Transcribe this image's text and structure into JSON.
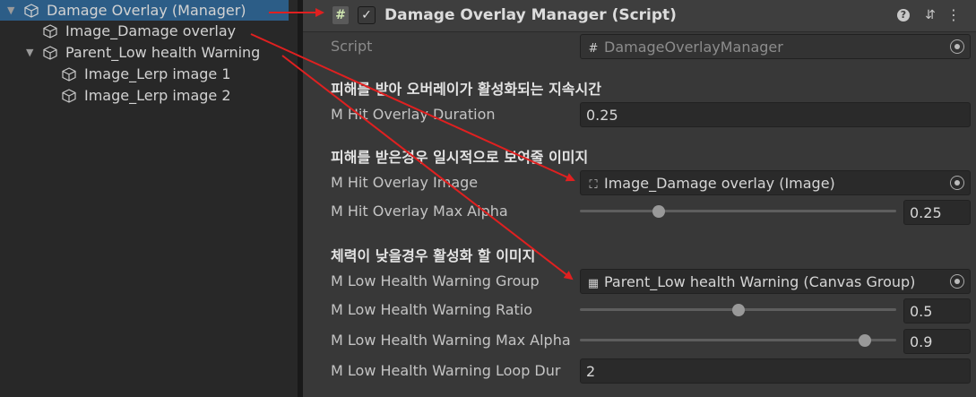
{
  "hierarchy": {
    "items": [
      {
        "label": "Damage Overlay (Manager)"
      },
      {
        "label": "Image_Damage overlay"
      },
      {
        "label": "Parent_Low health Warning"
      },
      {
        "label": "Image_Lerp image 1"
      },
      {
        "label": "Image_Lerp image 2"
      }
    ]
  },
  "inspector": {
    "component_title": "Damage Overlay Manager (Script)",
    "script": {
      "label": "Script",
      "value": "DamageOverlayManager"
    },
    "header1": "피해를 받아 오버레이가 활성화되는 지속시간",
    "hit_duration": {
      "label": "M Hit Overlay Duration",
      "value": "0.25"
    },
    "header2": "피해를 받은경우 일시적으로 보여줄 이미지",
    "hit_image": {
      "label": "M Hit Overlay Image",
      "value": "Image_Damage overlay (Image)"
    },
    "hit_alpha": {
      "label": "M Hit Overlay Max Alpha",
      "value": "0.25",
      "fraction": 0.25
    },
    "header3": "체력이 낮을경우 활성화 할 이미지",
    "low_group": {
      "label": "M Low Health Warning Group",
      "value": "Parent_Low health Warning (Canvas Group)"
    },
    "low_ratio": {
      "label": "M Low Health Warning Ratio",
      "value": "0.5",
      "fraction": 0.5
    },
    "low_alpha": {
      "label": "M Low Health Warning Max Alpha",
      "value": "0.9",
      "fraction": 0.9
    },
    "low_loop": {
      "label": "M Low Health Warning Loop Dur",
      "value": "2"
    }
  },
  "colors": {
    "selection": "#2c5d87",
    "arrow": "#e02020"
  },
  "icons": [
    "cube-icon",
    "script-icon",
    "checkbox-icon",
    "help-icon",
    "preset-icon",
    "more-icon",
    "object-picker-icon",
    "image-icon",
    "canvas-group-icon"
  ]
}
